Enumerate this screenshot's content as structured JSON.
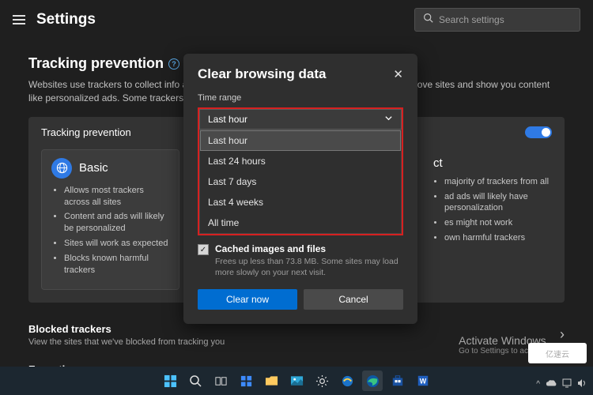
{
  "header": {
    "title": "Settings",
    "search_placeholder": "Search settings"
  },
  "tracking": {
    "heading": "Tracking prevention",
    "description": "Websites use trackers to collect info about your browsing. Websites may use this info to improve sites and show you content like personalized ads. Some trackers collect and send your info to sites you haven't visited.",
    "card_title": "Tracking prevention",
    "tiles": {
      "basic": {
        "name": "Basic",
        "bullets": [
          "Allows most trackers across all sites",
          "Content and ads will likely be personalized",
          "Sites will work as expected",
          "Blocks known harmful trackers"
        ]
      },
      "strict": {
        "name": "Strict",
        "bullets_partial": [
          "majority of trackers from all",
          "ad ads will likely have personalization",
          "es might not work",
          "own harmful trackers"
        ]
      }
    }
  },
  "blocked": {
    "title": "Blocked trackers",
    "desc": "View the sites that we've blocked from tracking you"
  },
  "exceptions": {
    "title": "Exceptions"
  },
  "modal": {
    "title": "Clear browsing data",
    "time_range_label": "Time range",
    "selected": "Last hour",
    "options": [
      "Last hour",
      "Last 24 hours",
      "Last 7 days",
      "Last 4 weeks",
      "All time"
    ],
    "check_label": "Cached images and files",
    "check_desc": "Frees up less than 73.8 MB. Some sites may load more slowly on your next visit.",
    "clear_label": "Clear now",
    "cancel_label": "Cancel"
  },
  "activate": {
    "line1": "Activate Windows",
    "line2": "Go to Settings to activate Windows."
  },
  "watermark": "亿速云"
}
